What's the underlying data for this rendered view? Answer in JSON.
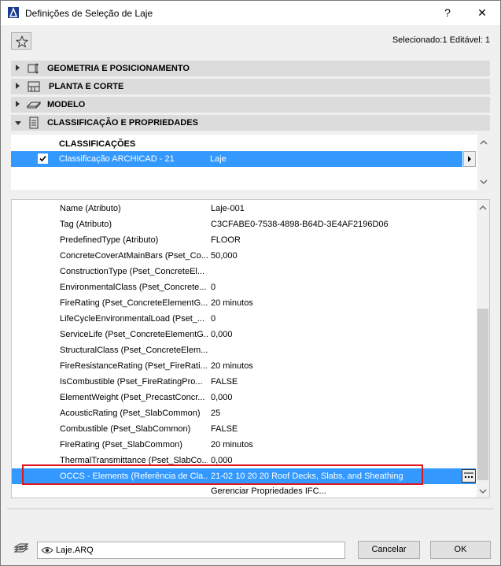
{
  "window": {
    "title": "Definições de Seleção de Laje",
    "help_label": "?",
    "close_label": "✕"
  },
  "header": {
    "selection_info": "Selecionado:1 Editável: 1"
  },
  "sections": [
    {
      "label": "GEOMETRIA E POSICIONAMENTO",
      "icon": "geometry-icon",
      "expanded": false
    },
    {
      "label": "PLANTA E CORTE",
      "icon": "floor-plan-icon",
      "expanded": false
    },
    {
      "label": "MODELO",
      "icon": "model-icon",
      "expanded": false
    },
    {
      "label": "CLASSIFICAÇÃO E PROPRIEDADES",
      "icon": "document-icon",
      "expanded": true
    }
  ],
  "classifications": {
    "header": "CLASSIFICAÇÕES",
    "row": {
      "name": "Classificação ARCHICAD - 21",
      "value": "Laje",
      "checked": true
    }
  },
  "properties": [
    {
      "name": "Name (Atributo)",
      "value": "Laje-001"
    },
    {
      "name": "Tag (Atributo)",
      "value": "C3CFABE0-7538-4898-B64D-3E4AF2196D06"
    },
    {
      "name": "PredefinedType (Atributo)",
      "value": "FLOOR"
    },
    {
      "name": "ConcreteCoverAtMainBars (Pset_Co...",
      "value": "50,000"
    },
    {
      "name": "ConstructionType (Pset_ConcreteEl...",
      "value": ""
    },
    {
      "name": "EnvironmentalClass (Pset_Concrete...",
      "value": "0"
    },
    {
      "name": "FireRating (Pset_ConcreteElementG...",
      "value": "20 minutos"
    },
    {
      "name": "LifeCycleEnvironmentalLoad (Pset_...",
      "value": "0"
    },
    {
      "name": "ServiceLife (Pset_ConcreteElementG...",
      "value": "0,000"
    },
    {
      "name": "StructuralClass (Pset_ConcreteElem...",
      "value": ""
    },
    {
      "name": "FireResistanceRating (Pset_FireRati...",
      "value": "20 minutos"
    },
    {
      "name": "IsCombustible (Pset_FireRatingPro...",
      "value": "FALSE"
    },
    {
      "name": "ElementWeight (Pset_PrecastConcr...",
      "value": "0,000"
    },
    {
      "name": "AcousticRating (Pset_SlabCommon)",
      "value": "25"
    },
    {
      "name": "Combustible (Pset_SlabCommon)",
      "value": "FALSE"
    },
    {
      "name": "FireRating (Pset_SlabCommon)",
      "value": "20 minutos"
    },
    {
      "name": "ThermalTransmittance (Pset_SlabCo...",
      "value": "0,000"
    },
    {
      "name": "OCCS - Elements (Referência de Cla...",
      "value": "21-02 10 20 20 Roof Decks, Slabs, and Sheathing"
    }
  ],
  "manage_properties_label": "Gerenciar Propriedades IFC...",
  "footer": {
    "layer_value": "Laje.ARQ",
    "cancel_label": "Cancelar",
    "ok_label": "OK"
  },
  "colors": {
    "selection": "#3399ff",
    "highlight_border": "#e0151b",
    "section_bg": "#dcdcdc"
  }
}
